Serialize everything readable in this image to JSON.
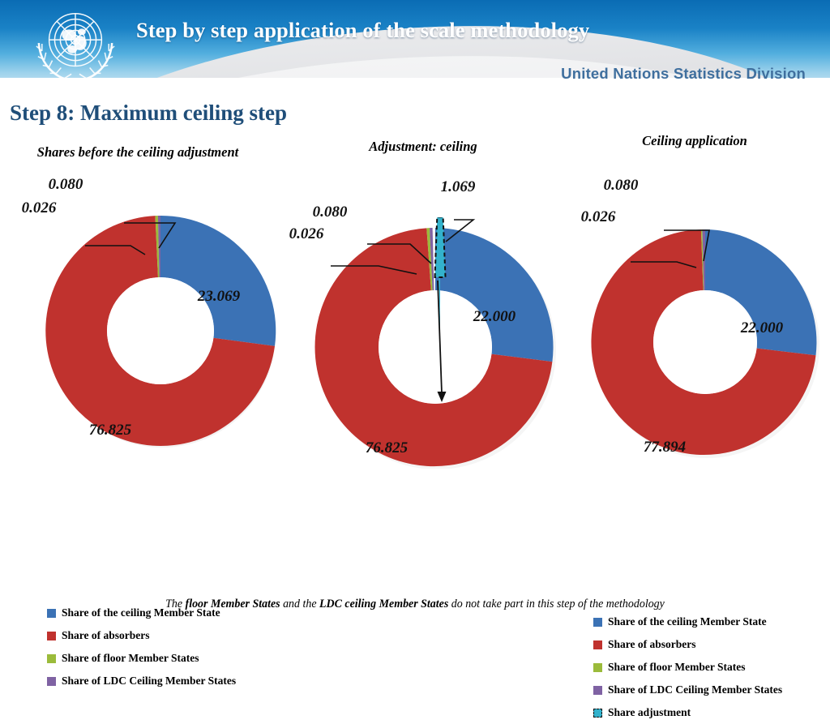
{
  "header": {
    "title": "Step by step application of the scale methodology",
    "subtitle": "United Nations Statistics Division",
    "emblem_name": "un-emblem-icon",
    "gradient_top": "#0a6cb4",
    "gradient_bottom": "#cfe6f3",
    "subtitle_color": "#3f6f9e"
  },
  "slide": {
    "title": "Step 8: Maximum ceiling step",
    "title_color": "#1F4E79",
    "footnote_parts": {
      "p1": "The ",
      "b1": "floor Member States",
      "p2": " and the ",
      "b2": "LDC ceiling Member States",
      "p3": " do not take part in this step of  the methodology"
    }
  },
  "series_colors": {
    "ceiling_member_state": "#3B72B5",
    "absorbers": "#C0322E",
    "floor_member_states": "#9BBB3B",
    "ldc_ceiling_member_states": "#7F62A3",
    "share_adjustment": "#33B2CC"
  },
  "legend_labels": {
    "ceiling_member_state": "Share of the ceiling Member State",
    "absorbers": "Share of absorbers",
    "floor_member_states": "Share of floor Member States",
    "ldc_ceiling_member_states": "Share of LDC Ceiling Member States",
    "share_adjustment": "Share adjustment"
  },
  "charts": [
    {
      "id": "chart-1",
      "title": "Shares before the ceiling adjustment",
      "labels_inside": {
        "blue": "23.069",
        "red": "76.825"
      },
      "labels_callout": {
        "purple": "0.080",
        "green": "0.026"
      }
    },
    {
      "id": "chart-2",
      "title": "Adjustment: ceiling",
      "labels_inside": {
        "blue": "22.000",
        "red": "76.825"
      },
      "labels_callout": {
        "cyan": "1.069",
        "purple": "0.080",
        "green": "0.026"
      }
    },
    {
      "id": "chart-3",
      "title": "Ceiling application",
      "labels_inside": {
        "blue": "22.000",
        "red": "77.894"
      },
      "labels_callout": {
        "purple": "0.080",
        "green": "0.026"
      }
    }
  ],
  "chart_data": [
    {
      "type": "pie",
      "id": "chart-1",
      "title": "Shares before the ceiling adjustment",
      "donut": true,
      "hole_ratio": 0.46,
      "start_angle": 0,
      "labels": [
        "Share of the ceiling Member State",
        "Share of absorbers",
        "Share of floor Member States",
        "Share of LDC Ceiling Member States"
      ],
      "values": [
        23.069,
        76.825,
        0.026,
        0.08
      ],
      "colors": [
        "#3B72B5",
        "#C0322E",
        "#9BBB3B",
        "#7F62A3"
      ],
      "legend_position": "bottom"
    },
    {
      "type": "pie",
      "id": "chart-2",
      "title": "Adjustment: ceiling",
      "donut": true,
      "hole_ratio": 0.46,
      "start_angle": 0,
      "labels": [
        "Share of the ceiling Member State",
        "Share of absorbers",
        "Share of floor Member States",
        "Share of LDC Ceiling Member States",
        "Share adjustment"
      ],
      "values": [
        22.0,
        76.825,
        0.026,
        0.08,
        1.069
      ],
      "colors": [
        "#3B72B5",
        "#C0322E",
        "#9BBB3B",
        "#7F62A3",
        "#33B2CC"
      ],
      "exploded_slice": "Share adjustment",
      "annotation": "arrow from Share adjustment slice into centre of donut",
      "legend_position": "bottom"
    },
    {
      "type": "pie",
      "id": "chart-3",
      "title": "Ceiling application",
      "donut": true,
      "hole_ratio": 0.46,
      "start_angle": 0,
      "labels": [
        "Share of the ceiling Member State",
        "Share of absorbers",
        "Share of floor Member States",
        "Share of LDC Ceiling Member States"
      ],
      "values": [
        22.0,
        77.894,
        0.026,
        0.08
      ],
      "colors": [
        "#3B72B5",
        "#C0322E",
        "#9BBB3B",
        "#7F62A3"
      ],
      "legend_position": "bottom"
    }
  ]
}
